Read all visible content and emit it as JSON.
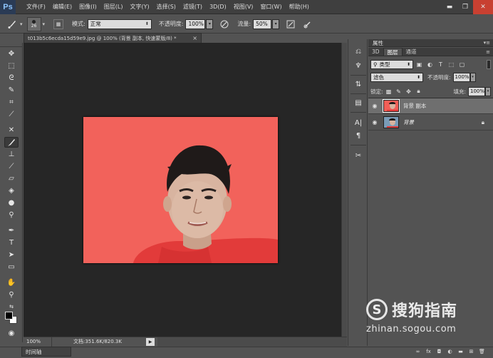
{
  "app": {
    "logo_text": "Ps"
  },
  "menu": [
    "文件(F)",
    "编辑(E)",
    "图像(I)",
    "图层(L)",
    "文字(Y)",
    "选择(S)",
    "滤镜(T)",
    "3D(D)",
    "视图(V)",
    "窗口(W)",
    "帮助(H)"
  ],
  "window_controls": {
    "minimize": "▬",
    "restore": "❐",
    "close": "✕"
  },
  "options_bar": {
    "brush_size": "26",
    "mode_label": "模式:",
    "mode_value": "正常",
    "opacity_label": "不透明度:",
    "opacity_value": "100%",
    "flow_label": "流量:",
    "flow_value": "50%"
  },
  "document": {
    "tab_title": "t013b5c6ecda15d59e9.jpg @ 100% (背景 副本, 快速蒙版/8) *",
    "close_symbol": "×",
    "zoom": "100%",
    "doc_info": "文档:351.6K/820.3K",
    "background_color": "#f25e57"
  },
  "timeline": {
    "label": "时间轴"
  },
  "panels": {
    "properties_title": "属性",
    "tabs": [
      "3D",
      "图层",
      "通道"
    ],
    "active_tab": "图层",
    "filter_kind": "类型",
    "blend_mode": "滤色",
    "opacity_label": "不透明度:",
    "opacity_value": "100%",
    "lock_label": "锁定:",
    "fill_label": "填充:",
    "fill_value": "100%",
    "layers": [
      {
        "name": "背景 副本",
        "selected": true,
        "locked": false
      },
      {
        "name": "背景",
        "selected": false,
        "locked": true
      }
    ]
  },
  "watermark": {
    "logo_letter": "S",
    "name": "搜狗指南",
    "url": "zhinan.sogou.com"
  },
  "colors": {
    "photo_background": "#f25e57",
    "workspace": "#262626",
    "ui_panel": "#535353",
    "menu_bar": "#3f3f3f",
    "close_button": "#c84031",
    "ps_logo_text": "#8fc6ff"
  }
}
